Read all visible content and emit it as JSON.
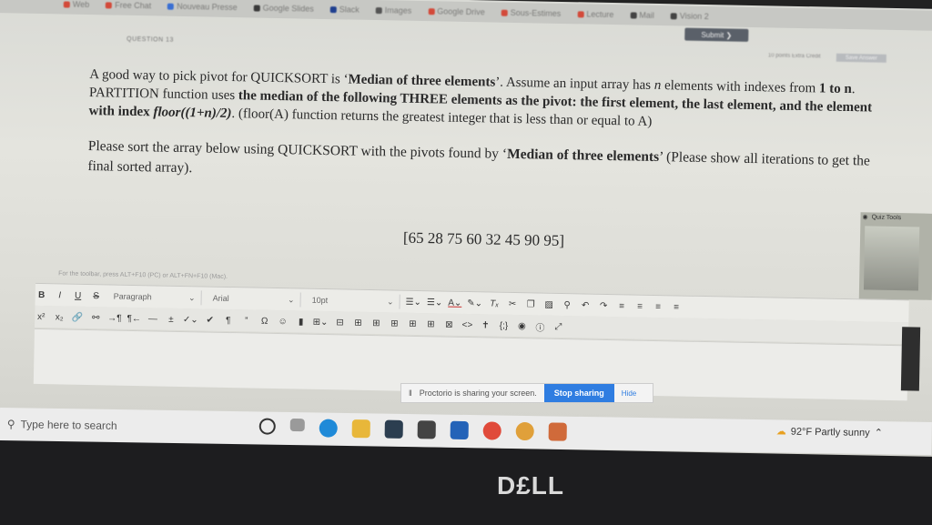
{
  "browser": {
    "bookmarks": [
      "Web",
      "Free Chat",
      "Nouveau Presse",
      "Google Slides",
      "Slack",
      "Images",
      "Google Drive",
      "Sous-Estimes",
      "Lecture",
      "Mail",
      "Vision 2"
    ]
  },
  "quiz": {
    "submit_label": "Submit",
    "question_number": "QUESTION 13",
    "points_label": "10 points  Extra Credit",
    "save_label": "Save Answer",
    "paragraph1_parts": [
      "A good way to pick pivot for QUICKSORT is ‘",
      "Median of three elements",
      "’. Assume an input array has ",
      "n",
      " elements with indexes from ",
      "1 to n",
      ". PARTITION function uses ",
      "the median of the following THREE elements as the pivot: the first element, the last element, and the element with index ",
      "floor((1+n)/2)",
      ". (floor(A) function returns the greatest integer that is less than or equal to A)"
    ],
    "paragraph2_parts": [
      "Please sort the array below using QUICKSORT with the pivots found by ‘",
      "Median of three elements",
      "’ (Please show all iterations to get the final sorted array)."
    ],
    "array_text": "[65 28 75 60 32 45 90 95]"
  },
  "editor": {
    "hint": "For the toolbar, press ALT+F10 (PC) or ALT+FN+F10 (Mac).",
    "bold": "B",
    "italic": "I",
    "underline": "U",
    "strike": "S",
    "paragraph_select": "Paragraph",
    "font_select": "Arial",
    "size_select": "10pt",
    "superscript": "x²",
    "subscript": "x₂",
    "pilcrow": "¶",
    "quote": "”",
    "omega": "Ω",
    "code": "<>",
    "braces": "{;}"
  },
  "quiz_tools": {
    "label": "Quiz Tools"
  },
  "proctorio": {
    "message": "Proctorio is sharing your screen.",
    "stop_label": "Stop sharing",
    "hide_label": "Hide"
  },
  "taskbar": {
    "search_placeholder": "Type here to search",
    "weather": "92°F  Partly sunny"
  },
  "device": {
    "brand": "D£LL"
  }
}
